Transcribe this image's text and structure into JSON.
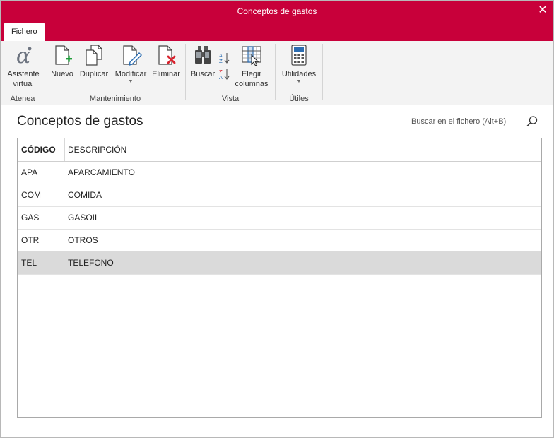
{
  "window": {
    "title": "Conceptos de gastos",
    "close_label": "✕"
  },
  "tabs": [
    {
      "label": "Fichero"
    }
  ],
  "ribbon": {
    "groups": [
      {
        "label": "Atenea",
        "buttons": [
          {
            "label": "Asistente virtual",
            "icon": "alpha-icon"
          }
        ]
      },
      {
        "label": "Mantenimiento",
        "buttons": [
          {
            "label": "Nuevo",
            "icon": "new-document-icon"
          },
          {
            "label": "Duplicar",
            "icon": "duplicate-icon"
          },
          {
            "label": "Modificar",
            "icon": "edit-document-icon",
            "dropdown": true
          },
          {
            "label": "Eliminar",
            "icon": "delete-document-icon"
          }
        ]
      },
      {
        "label": "Vista",
        "buttons": [
          {
            "label": "Buscar",
            "icon": "binoculars-icon"
          },
          {
            "label": "Elegir columnas",
            "icon": "choose-columns-icon"
          }
        ]
      },
      {
        "label": "Útiles",
        "buttons": [
          {
            "label": "Utilidades",
            "icon": "calculator-icon",
            "dropdown": true
          }
        ]
      }
    ]
  },
  "main": {
    "title": "Conceptos de gastos",
    "search": {
      "placeholder": "Buscar en el fichero (Alt+B)",
      "value": ""
    },
    "table": {
      "columns": [
        "CÓDIGO",
        "DESCRIPCIÓN"
      ],
      "rows": [
        {
          "code": "APA",
          "description": "APARCAMIENTO"
        },
        {
          "code": "COM",
          "description": "COMIDA"
        },
        {
          "code": "GAS",
          "description": "GASOIL"
        },
        {
          "code": "OTR",
          "description": "OTROS"
        },
        {
          "code": "TEL",
          "description": "TELEFONO",
          "selected": true
        }
      ]
    }
  },
  "colors": {
    "accent": "#c8003a",
    "ribbon_bg": "#f3f3f3",
    "selected_row": "#dadada",
    "green_plus": "#1f9d3a",
    "red_x": "#d9232e",
    "blue_icon": "#2b6cb0"
  }
}
